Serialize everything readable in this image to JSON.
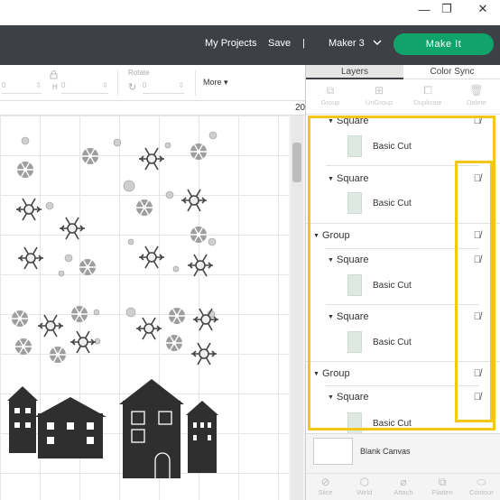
{
  "window": {
    "minimize": "—",
    "restore": "❐",
    "close": "✕"
  },
  "header": {
    "my_projects": "My Projects",
    "save": "Save",
    "separator": "|",
    "machine": "Maker 3",
    "make_it": "Make It"
  },
  "toolbar": {
    "h_label": "H",
    "rotate_label": "Rotate",
    "w_value": "0",
    "h_value": "0",
    "rotate_value": "0",
    "more_label": "More"
  },
  "ruler": {
    "mark": "20"
  },
  "panel": {
    "tabs": [
      "Layers",
      "Color Sync"
    ],
    "actions": [
      {
        "label": "Group",
        "icon": "group-icon"
      },
      {
        "label": "UnGroup",
        "icon": "ungroup-icon"
      },
      {
        "label": "Duplicate",
        "icon": "duplicate-icon"
      },
      {
        "label": "Delete",
        "icon": "trash-icon"
      }
    ],
    "layers": [
      {
        "type": "Square",
        "sub": "Basic Cut"
      },
      {
        "type": "Square",
        "sub": "Basic Cut"
      },
      {
        "type": "Group"
      },
      {
        "type": "Square",
        "sub": "Basic Cut"
      },
      {
        "type": "Square",
        "sub": "Basic Cut"
      },
      {
        "type": "Group"
      },
      {
        "type": "Square",
        "sub": "Basic Cut"
      }
    ],
    "blank_canvas": "Blank Canvas",
    "bottom_actions": [
      {
        "label": "Slice",
        "icon": "slice-icon"
      },
      {
        "label": "Weld",
        "icon": "weld-icon"
      },
      {
        "label": "Attach",
        "icon": "attach-icon"
      },
      {
        "label": "Flatten",
        "icon": "flatten-icon"
      },
      {
        "label": "Contour",
        "icon": "contour-icon"
      }
    ]
  },
  "colors": {
    "header": "#3d4146",
    "make_it": "#11a46a",
    "highlight": "#f5c518",
    "shape": "#2f2f2f"
  }
}
